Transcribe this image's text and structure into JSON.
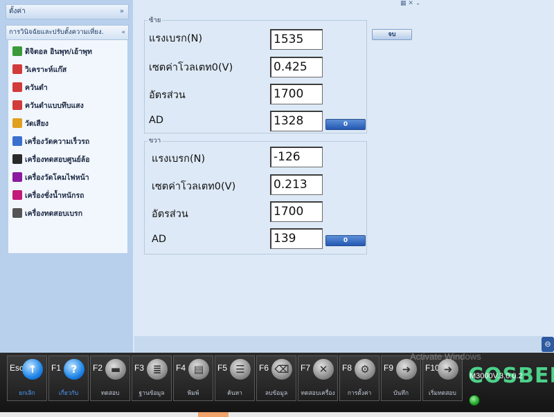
{
  "sidebar": {
    "header": "ตั้งค่า",
    "section": "การวินิจฉัยและปรับตั้งความเที่ยง.",
    "items": [
      {
        "label": "ดิจิตอล อินพุท/เอ้าพุท",
        "icon": "digital-io-icon",
        "color": "#3a9a3a"
      },
      {
        "label": "วิเคราะห์แก๊ส",
        "icon": "gas-analyzer-icon",
        "color": "#d23b3b"
      },
      {
        "label": "ควันดำ",
        "icon": "smoke-icon",
        "color": "#d23b3b"
      },
      {
        "label": "ควันดำแบบทึบแสง",
        "icon": "opacity-smoke-icon",
        "color": "#d23b3b"
      },
      {
        "label": "วัดเสียง",
        "icon": "sound-meter-icon",
        "color": "#e0a020"
      },
      {
        "label": "เครื่องวัดความเร็วรถ",
        "icon": "speedometer-icon",
        "color": "#3a6fd0"
      },
      {
        "label": "เครื่องทดสอบศูนย์ล้อ",
        "icon": "wheel-alignment-icon",
        "color": "#2a2a2a"
      },
      {
        "label": "เครื่องวัดโคมไฟหน้า",
        "icon": "headlight-icon",
        "color": "#8a1aa0"
      },
      {
        "label": "เครื่องชั่งน้ำหนักรถ",
        "icon": "scale-icon",
        "color": "#c21a7a"
      },
      {
        "label": "เครื่องทดสอบเบรก",
        "icon": "brake-tester-icon",
        "color": "#555555"
      }
    ]
  },
  "left_group": {
    "title": "ซ้าย",
    "fields": [
      {
        "label": "แรงเบรก(N)",
        "value": "1535"
      },
      {
        "label": "เซตค่าโวลเตท0(V)",
        "value": "0.425"
      },
      {
        "label": "อัตรส่วน",
        "value": "1700"
      },
      {
        "label": "AD",
        "value": "1328"
      }
    ],
    "zero_button": "0"
  },
  "right_group": {
    "title": "ขวา",
    "fields": [
      {
        "label": "แรงเบรก(N)",
        "value": "-126"
      },
      {
        "label": "เซตค่าโวลเตท0(V)",
        "value": "0.213"
      },
      {
        "label": "อัตรส่วน",
        "value": "1700"
      },
      {
        "label": "AD",
        "value": "139"
      }
    ],
    "zero_button": "0"
  },
  "close_button": "จบ",
  "function_keys": [
    {
      "key": "Esc",
      "label": "ยกเลิก",
      "icon": "arrow-up-icon",
      "glyph": "↑",
      "active": true
    },
    {
      "key": "F1",
      "label": "เกี่ยวกับ",
      "icon": "help-icon",
      "glyph": "?",
      "active": true
    },
    {
      "key": "F2",
      "label": "ทดสอบ",
      "icon": "car-icon",
      "glyph": "▬",
      "active": false
    },
    {
      "key": "F3",
      "label": "ฐานข้อมูล",
      "icon": "database-icon",
      "glyph": "≣",
      "active": false
    },
    {
      "key": "F4",
      "label": "พิมพ์",
      "icon": "printer-icon",
      "glyph": "▤",
      "active": false
    },
    {
      "key": "F5",
      "label": "ค้นหา",
      "icon": "search-doc-icon",
      "glyph": "☰",
      "active": false
    },
    {
      "key": "F6",
      "label": "ลบข้อมูล",
      "icon": "trash-icon",
      "glyph": "⌫",
      "active": false
    },
    {
      "key": "F7",
      "label": "ทดสอบเครื่อง",
      "icon": "tools-icon",
      "glyph": "✕",
      "active": false
    },
    {
      "key": "F8",
      "label": "การตั้งค่า",
      "icon": "wrench-icon",
      "glyph": "⚙",
      "active": false
    },
    {
      "key": "F9",
      "label": "บันทึก",
      "icon": "save-arrow-icon",
      "glyph": "➜",
      "active": false
    },
    {
      "key": "F10",
      "label": "เริ่มทดสอบ",
      "icon": "start-arrow-icon",
      "glyph": "➜",
      "active": false
    }
  ],
  "logo": "COSBER",
  "version": "M3000V.3.0.0.2",
  "watermark": "Activate Windows"
}
